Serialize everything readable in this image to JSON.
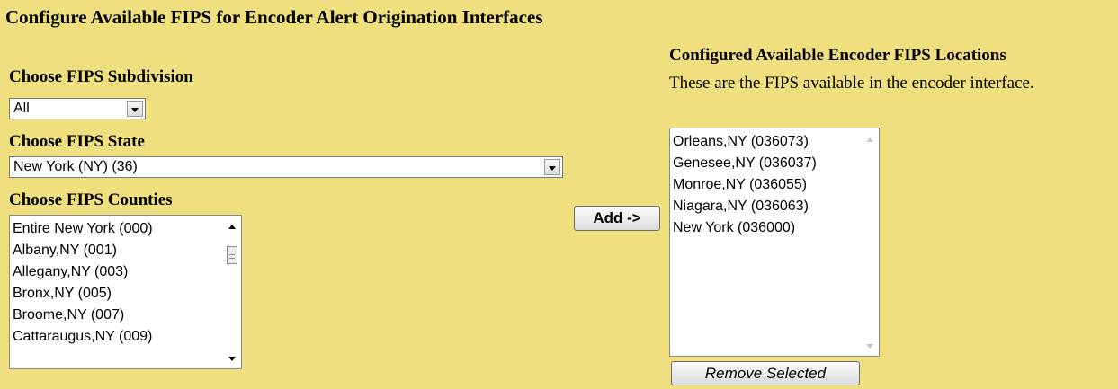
{
  "page": {
    "title": "Configure Available FIPS for Encoder Alert Origination Interfaces"
  },
  "subdivision": {
    "label": "Choose FIPS Subdivision",
    "selected": "All"
  },
  "state": {
    "label": "Choose FIPS State",
    "selected": "New York (NY) (36)"
  },
  "counties": {
    "label": "Choose FIPS Counties",
    "items": [
      "Entire New York (000)",
      "Albany,NY (001)",
      "Allegany,NY (003)",
      "Bronx,NY (005)",
      "Broome,NY (007)",
      "Cattaraugus,NY (009)"
    ]
  },
  "add_button": {
    "label": "Add ->"
  },
  "configured": {
    "heading": "Configured Available Encoder FIPS Locations",
    "description": "These are the FIPS available in the encoder interface.",
    "items": [
      "Orleans,NY (036073)",
      "Genesee,NY (036037)",
      "Monroe,NY (036055)",
      "Niagara,NY (036063)",
      "New York (036000)"
    ]
  },
  "remove_button": {
    "label": "Remove Selected"
  },
  "icons": {
    "dropdown": "chevron-down-icon",
    "scroll_up": "scroll-up-arrow-icon",
    "scroll_down": "scroll-down-arrow-icon",
    "scroll_thumb": "scrollbar-thumb"
  },
  "colors": {
    "background": "#f0df7f",
    "field_background": "#ffffff"
  }
}
